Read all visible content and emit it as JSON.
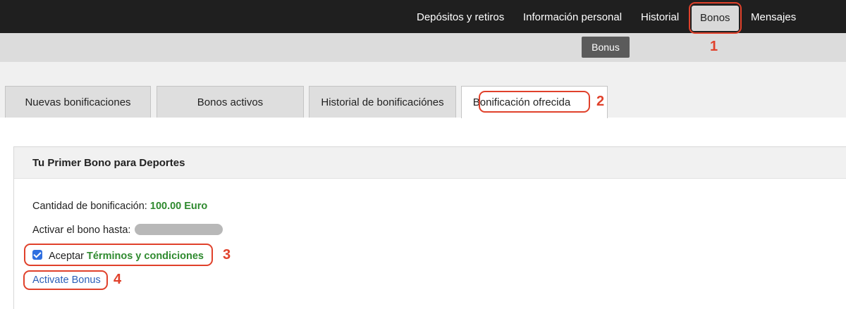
{
  "topnav": {
    "items": [
      {
        "label": "Depósitos y retiros"
      },
      {
        "label": "Información personal"
      },
      {
        "label": "Historial"
      },
      {
        "label": "Bonos"
      },
      {
        "label": "Mensajes"
      }
    ]
  },
  "subnav": {
    "button_label": "Bonus"
  },
  "tabs": [
    {
      "label": "Nuevas bonificaciones"
    },
    {
      "label": "Bonos activos"
    },
    {
      "label": "Historial de bonificaciónes"
    },
    {
      "label": "Bonificación ofrecida"
    }
  ],
  "panel": {
    "title": "Tu Primer Bono para Deportes",
    "amount_label": "Cantidad de bonificación:",
    "amount_value": "100.00 Euro",
    "activate_until_label": "Activar el bono hasta:",
    "accept_label": "Aceptar",
    "terms_link": "Términos y condiciones",
    "terms_checked": true,
    "activate_link": "Activate Bonus"
  },
  "annotations": [
    "1",
    "2",
    "3",
    "4"
  ],
  "colors": {
    "annotation": "#e0412b",
    "accent_green": "#2f8a2f",
    "link_blue": "#2b5fb8",
    "topnav_bg": "#1f1f1f"
  }
}
